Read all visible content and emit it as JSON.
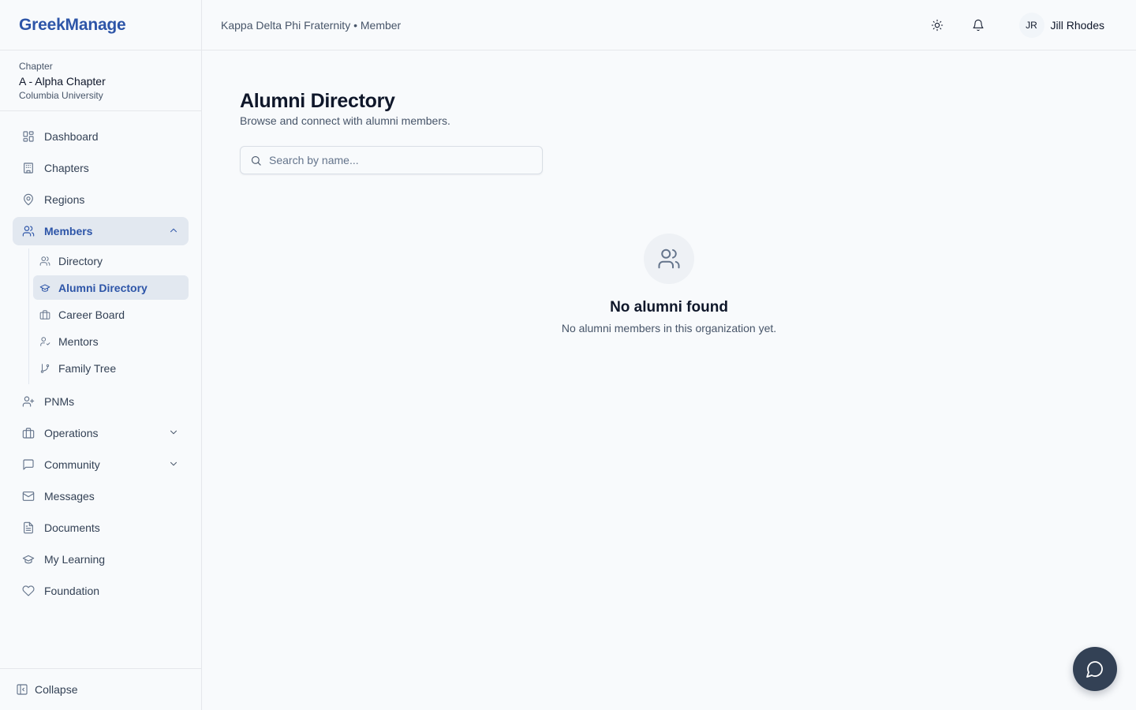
{
  "brand": {
    "name": "GreekManage"
  },
  "chapter": {
    "label": "Chapter",
    "name": "A - Alpha Chapter",
    "university": "Columbia University"
  },
  "topbar": {
    "org_line": "Kappa Delta Phi Fraternity • Member",
    "user_initials": "JR",
    "user_name": "Jill Rhodes"
  },
  "sidebar": {
    "items": [
      {
        "label": "Dashboard",
        "icon": "grid-icon"
      },
      {
        "label": "Chapters",
        "icon": "building-icon"
      },
      {
        "label": "Regions",
        "icon": "map-pin-icon"
      },
      {
        "label": "Members",
        "icon": "users-icon",
        "expanded": true
      },
      {
        "label": "PNMs",
        "icon": "user-plus-icon"
      },
      {
        "label": "Operations",
        "icon": "briefcase-icon"
      },
      {
        "label": "Community",
        "icon": "message-square-icon"
      },
      {
        "label": "Messages",
        "icon": "mail-icon"
      },
      {
        "label": "Documents",
        "icon": "file-icon"
      },
      {
        "label": "My Learning",
        "icon": "graduation-cap-icon"
      },
      {
        "label": "Foundation",
        "icon": "heart-icon"
      }
    ],
    "members_sub": [
      {
        "label": "Directory",
        "icon": "users-icon"
      },
      {
        "label": "Alumni Directory",
        "icon": "graduation-cap-icon",
        "active": true
      },
      {
        "label": "Career Board",
        "icon": "briefcase-icon"
      },
      {
        "label": "Mentors",
        "icon": "user-check-icon"
      },
      {
        "label": "Family Tree",
        "icon": "git-branch-icon"
      }
    ],
    "collapse_label": "Collapse"
  },
  "main": {
    "title": "Alumni Directory",
    "subtitle": "Browse and connect with alumni members.",
    "search_placeholder": "Search by name...",
    "search_value": "",
    "empty_title": "No alumni found",
    "empty_desc": "No alumni members in this organization yet."
  },
  "colors": {
    "accent": "#2d55a8",
    "active_bg": "#e2e8f0",
    "fab": "#334155"
  }
}
